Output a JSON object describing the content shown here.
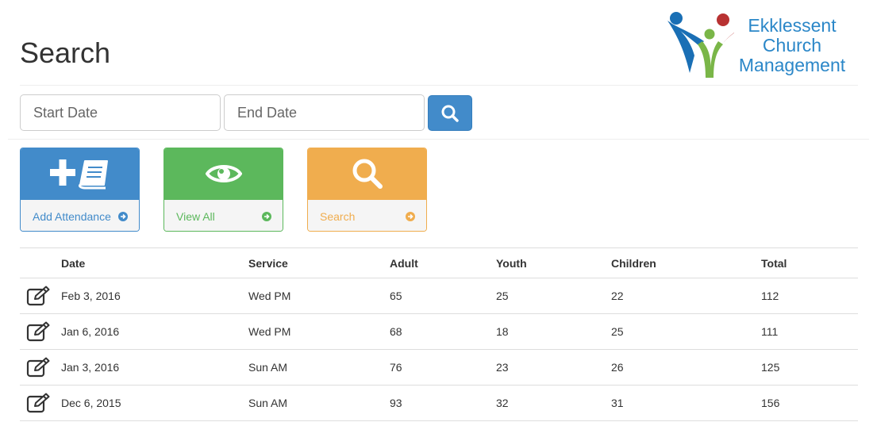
{
  "header": {
    "title": "Search",
    "logo": {
      "line1": "Ekklessent",
      "line2": "Church",
      "line3": "Management"
    }
  },
  "search": {
    "start_placeholder": "Start Date",
    "start_value": "",
    "end_placeholder": "End Date",
    "end_value": "",
    "button_icon": "search-icon"
  },
  "tiles": [
    {
      "label": "Add Attendance",
      "icon": "plus-book-icon",
      "color": "#428bca"
    },
    {
      "label": "View All",
      "icon": "eye-icon",
      "color": "#5cb85c"
    },
    {
      "label": "Search",
      "icon": "search-icon",
      "color": "#f0ad4e"
    }
  ],
  "table": {
    "columns": [
      "Date",
      "Service",
      "Adult",
      "Youth",
      "Children",
      "Total"
    ],
    "rows": [
      {
        "date": "Feb 3, 2016",
        "service": "Wed PM",
        "adult": "65",
        "youth": "25",
        "children": "22",
        "total": "112"
      },
      {
        "date": "Jan 6, 2016",
        "service": "Wed PM",
        "adult": "68",
        "youth": "18",
        "children": "25",
        "total": "111"
      },
      {
        "date": "Jan 3, 2016",
        "service": "Sun AM",
        "adult": "76",
        "youth": "23",
        "children": "26",
        "total": "125"
      },
      {
        "date": "Dec 6, 2015",
        "service": "Sun AM",
        "adult": "93",
        "youth": "32",
        "children": "31",
        "total": "156"
      }
    ]
  }
}
